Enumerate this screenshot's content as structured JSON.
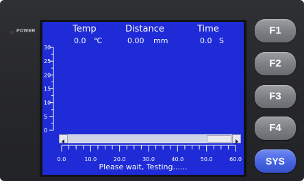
{
  "device": {
    "power_label": "POWER"
  },
  "screen": {
    "headers": {
      "temp_label": "Temp",
      "temp_value": "0.0",
      "temp_unit": "℃",
      "distance_label": "Distance",
      "distance_value": "0.00",
      "distance_unit": "mm",
      "time_label": "Time",
      "time_value": "0.0",
      "time_unit": "S"
    },
    "status": "Please wait, Testing......"
  },
  "keys": {
    "f1": "F1",
    "f2": "F2",
    "f3": "F3",
    "f4": "F4",
    "sys": "SYS"
  },
  "colors": {
    "screen_bg": "#1e2bd6",
    "sys_key": "#4563e4",
    "function_key": "#7d8084"
  },
  "chart_data": {
    "type": "line",
    "title": "",
    "xlabel": "",
    "ylabel": "",
    "x_ticks": [
      "0.0",
      "10.0",
      "20.0",
      "30.0",
      "40.0",
      "50.0",
      "60.0"
    ],
    "y_ticks": [
      "0",
      "5",
      "10",
      "15",
      "20",
      "25",
      "30"
    ],
    "xlim": [
      0,
      60
    ],
    "ylim": [
      0,
      30
    ],
    "series": []
  }
}
